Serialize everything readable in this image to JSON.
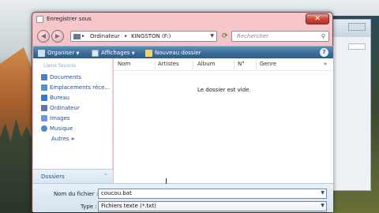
{
  "window": {
    "title": "Enregistrer sous"
  },
  "address": {
    "part1": "Ordinateur",
    "part2": "KINGSTON (F:)"
  },
  "search": {
    "placeholder": "Rechercher"
  },
  "toolbar": {
    "organize": "Organiser",
    "views": "Affichages",
    "new_folder": "Nouveau dossier"
  },
  "sidebar": {
    "header": "Liens favoris",
    "items": [
      {
        "label": "Documents",
        "icon": "documents-icon",
        "color": "#4a7fc0"
      },
      {
        "label": "Emplacements réce...",
        "icon": "recent-places-icon",
        "color": "#5a8fc8"
      },
      {
        "label": "Bureau",
        "icon": "desktop-icon",
        "color": "#3a78c8"
      },
      {
        "label": "Ordinateur",
        "icon": "computer-icon",
        "color": "#5a7aa0"
      },
      {
        "label": "Images",
        "icon": "pictures-icon",
        "color": "#6a9ad0"
      },
      {
        "label": "Musique",
        "icon": "music-icon",
        "color": "#4a8ac8"
      },
      {
        "label": "Autres",
        "icon": "more-icon",
        "color": ""
      }
    ],
    "folders": "Dossiers"
  },
  "columns": [
    "Nom",
    "Artistes",
    "Album",
    "N°",
    "Genre"
  ],
  "empty_message": "Le dossier est vide.",
  "filename": {
    "label": "Nom du fichier :",
    "value": "coucou.bat"
  },
  "filetype": {
    "label": "Type :",
    "value": "Fichiers texte (*.txt)"
  }
}
